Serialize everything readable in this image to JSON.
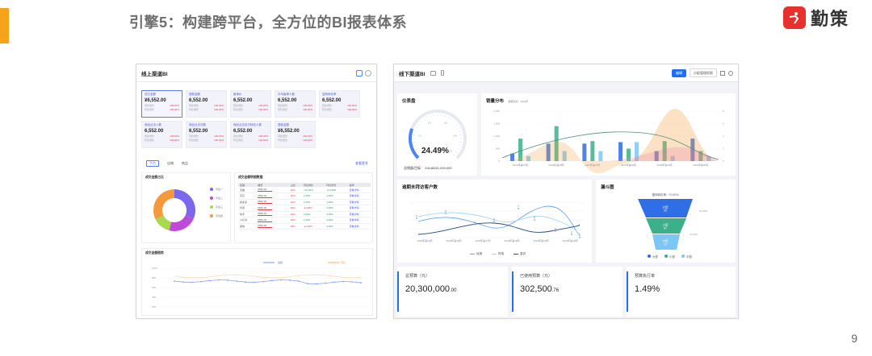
{
  "slide": {
    "title": "引擎5：构建跨平台，全方位的BI报表体系",
    "logo_text": "勤策",
    "page_number": "9",
    "accent_color": "#f6a21b",
    "logo_color": "#e8312d"
  },
  "online_bi": {
    "title": "线上渠道BI",
    "kpis": [
      {
        "label": "成交金额",
        "value": "¥6,552.00",
        "r1": "同比增长",
        "v1": "100.00%",
        "r2": "环比增长",
        "v2": "100.00%"
      },
      {
        "label": "退款金额",
        "value": "6,552.00",
        "r1": "同比增长",
        "v1": "100.00%",
        "r2": "环比增长",
        "v2": "100.00%"
      },
      {
        "label": "客单价",
        "value": "6,552.00",
        "r1": "同比增长",
        "v1": "100.00%",
        "r2": "环比增长",
        "v2": "100.00%"
      },
      {
        "label": "平均客单人数",
        "value": "6,552.00",
        "r1": "同比增长",
        "v1": "100.00%",
        "r2": "环比增长",
        "v2": "100.00%"
      },
      {
        "label": "复购转化率",
        "value": "6,552.00",
        "r1": "同比增长",
        "v1": "100.00%",
        "r2": "环比增长",
        "v2": "100.00%"
      },
      {
        "label": "商品点击人数",
        "value": "6,552.00",
        "r1": "同比增长",
        "v1": "100.00%",
        "r2": "环比增长",
        "v2": "100.00%"
      },
      {
        "label": "商品点击次数",
        "value": "6,552.00",
        "r1": "同比增长",
        "v1": "100.00%",
        "r2": "环比增长",
        "v2": "100.00%"
      },
      {
        "label": "商品点击支付转化人数",
        "value": "6,552.00",
        "r1": "同比增长",
        "v1": "100.00%",
        "r2": "环比增长",
        "v2": "100.00%"
      },
      {
        "label": "退款金额",
        "value": "¥6,552.00",
        "r1": "同比增长",
        "v1": "100.00%",
        "r2": "环比增长",
        "v2": "100.00%"
      }
    ],
    "tabs": [
      "平台",
      "店铺",
      "商品"
    ],
    "more_label": "查看更多",
    "donut_title": "成交金额占比",
    "donut_legend": [
      "平台一",
      "平台二",
      "平台三",
      "平台四"
    ],
    "donut_values": [
      0.32,
      0.22,
      0.14,
      0.32
    ],
    "donut_colors": [
      "#7b68ee",
      "#c04ad8",
      "#a8d84e",
      "#f49a3c"
    ],
    "table_title": "成交金额明细数据",
    "table_headers": [
      "店铺",
      "数值",
      "占比",
      "同比增长",
      "环比增长",
      "操作"
    ],
    "table_rows": [
      [
        "天猫",
        "6552.00",
        "20%",
        "+10.00%",
        "+10.00%",
        "查看详情"
      ],
      [
        "京东",
        "6552.00",
        "20%",
        "1.00%",
        "1.00%",
        "查看详情"
      ],
      [
        "拼多多",
        "6552.00",
        "20%",
        "1.00%",
        "1.00%",
        "查看详情"
      ],
      [
        "抖音",
        "6552.00",
        "20%",
        "-11.00%",
        "1.00%",
        "查看详情"
      ],
      [
        "快手",
        "6552.00",
        "20%",
        "1.00%",
        "1.00%",
        "查看详情"
      ],
      [
        "小红书",
        "6552.00",
        "20%",
        "1.00%",
        "1.00%",
        "查看详情"
      ],
      [
        "其他",
        "6552.00",
        "20%",
        "-11.00%",
        "1.00%",
        "查看详情"
      ]
    ],
    "trend_title": "成交金额趋势",
    "trend_legend": [
      "金额",
      "同比"
    ],
    "trend_yticks": [
      "1000",
      "800",
      "600",
      "400",
      "200"
    ]
  },
  "offline_bi": {
    "title": "线下渠道BI",
    "edit_label": "编辑",
    "share_label": "分配管理权限",
    "gauge": {
      "title": "仪表盘",
      "percent": "24.49%",
      "summary": "总销量/目标：  244,883/1,000,000",
      "ticks": [
        "0",
        "0.2",
        "0.4",
        "0.6",
        "0.8",
        "1.0"
      ],
      "fraction": 0.2449
    },
    "sales": {
      "title": "销量分布",
      "note": "数据来源：2023年",
      "categories": [
        "2023年第26周",
        "2023年第28周",
        "2023年第27周",
        "2023年第28周",
        "2023年第29周",
        "2023年第30周"
      ],
      "yticks": [
        "2,000",
        "1,500",
        "1,000",
        "500",
        "0"
      ],
      "y2ticks": [
        "8",
        "6",
        "4",
        "2",
        "0"
      ]
    },
    "visit": {
      "title": "逾期未拜访客户数",
      "categories": [
        "2023年第26周",
        "2023年第28周",
        "2023年第27周",
        "2023年第28周",
        "2023年第29周",
        "2023年第30周"
      ],
      "legend": [
        "经销",
        "终端",
        "直供"
      ],
      "point_labels": [
        "4",
        "5",
        "3",
        "2",
        "7",
        "6",
        "2",
        "1",
        "1"
      ]
    },
    "funnel": {
      "title": "漏斗图",
      "conv_label": "整体转化率：70.00%",
      "stages": [
        {
          "name": "大型",
          "value": "26"
        },
        {
          "name": "小型",
          "value": "67"
        },
        {
          "name": "中型",
          "value": "20"
        }
      ],
      "side_labels": [
        "60.00%",
        "15.00%"
      ],
      "legend": [
        "大型",
        "小型",
        "中型"
      ],
      "colors": [
        "#2f6ee6",
        "#3bb08a",
        "#7cc7f5"
      ]
    },
    "kpis": [
      {
        "label": "总预算（元）",
        "value": "20,300,000",
        "decimals": ".00"
      },
      {
        "label": "已使用预算（元）",
        "value": "302,500",
        "decimals": ".76"
      },
      {
        "label": "预算执行率",
        "value": "1.49%",
        "decimals": ""
      }
    ]
  }
}
